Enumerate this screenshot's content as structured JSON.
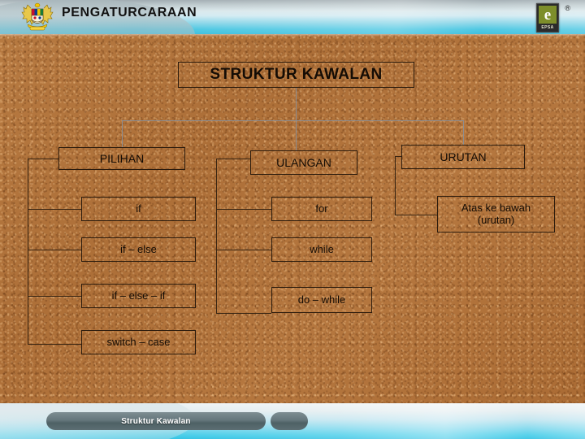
{
  "header": {
    "title": "PENGATURCARAAN",
    "crest_icon": "malaysia-coat-of-arms-icon",
    "logo_icon": "epsa-logo-icon",
    "logo_letter": "e",
    "logo_text": "EPSA",
    "registered_mark": "®"
  },
  "footer": {
    "label": "Struktur Kawalan"
  },
  "diagram": {
    "title": "STRUKTUR KAWALAN",
    "categories": [
      {
        "label": "PILIHAN"
      },
      {
        "label": "ULANGAN"
      },
      {
        "label": "URUTAN"
      }
    ],
    "pilihan_items": [
      {
        "label": "if"
      },
      {
        "label": "if – else"
      },
      {
        "label": "if – else – if"
      },
      {
        "label": "switch – case"
      }
    ],
    "ulangan_items": [
      {
        "label": "for"
      },
      {
        "label": "while"
      },
      {
        "label": "do – while"
      }
    ],
    "urutan_items": [
      {
        "label": "Atas ke bawah\n(urutan)",
        "line1": "Atas ke bawah",
        "line2": "(urutan)"
      }
    ]
  },
  "colors": {
    "background_brown": "#b0733c",
    "header_cyan": "#3cc3e0",
    "box_border": "#2b1b0d",
    "text_dark": "#140c05",
    "connector_light": "#8d8d90",
    "footer_pill": "#65777c",
    "logo_green": "#7d8e2a"
  }
}
